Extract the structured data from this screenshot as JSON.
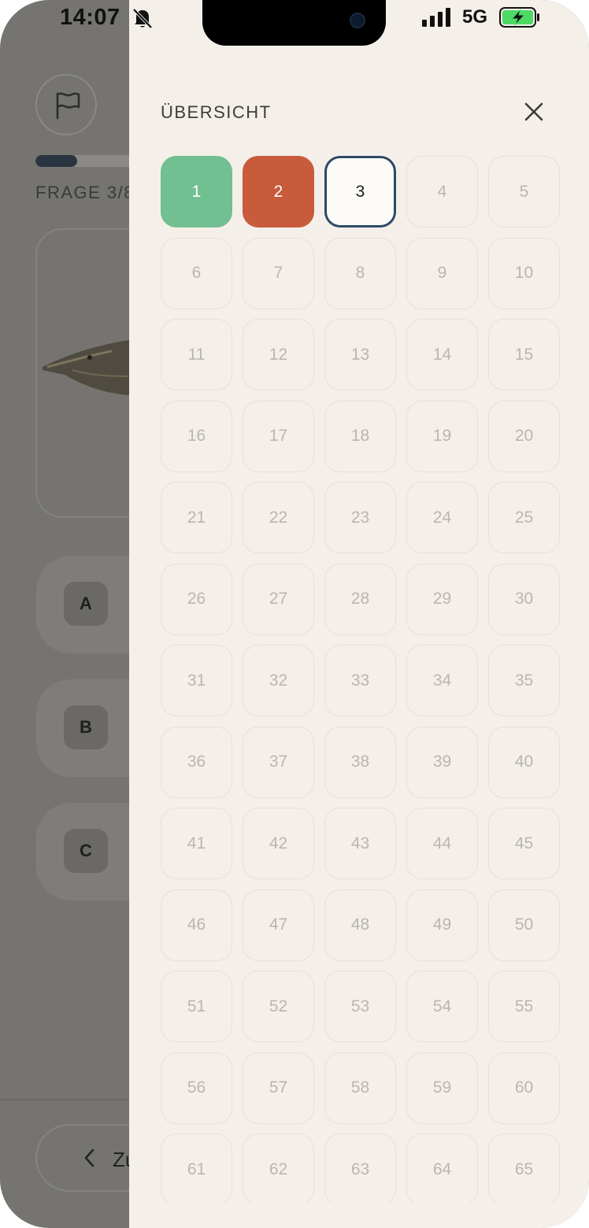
{
  "status_bar": {
    "time": "14:07",
    "network": "5G",
    "icons": [
      "bell-muted-icon",
      "signal-icon",
      "battery-charging-icon"
    ]
  },
  "background_screen": {
    "progress_fraction": 0.375,
    "question_counter_visible": "FRAGE 3/8",
    "answers": [
      "A",
      "B",
      "C"
    ],
    "back_button_visible": "Zu",
    "icons": [
      "flag-icon",
      "chevron-left-icon",
      "pike-fish-image"
    ]
  },
  "overview": {
    "title": "ÜBERSICHT",
    "close_icon": "close-icon",
    "colors": {
      "correct": "#72bf92",
      "wrong": "#c85b3c",
      "current_border": "#2e4a66"
    },
    "questions": [
      {
        "label": "1",
        "state": "correct"
      },
      {
        "label": "2",
        "state": "wrong"
      },
      {
        "label": "3",
        "state": "current"
      },
      {
        "label": "4",
        "state": "open"
      },
      {
        "label": "5",
        "state": "open"
      },
      {
        "label": "6",
        "state": "open"
      },
      {
        "label": "7",
        "state": "open"
      },
      {
        "label": "8",
        "state": "open"
      },
      {
        "label": "9",
        "state": "open"
      },
      {
        "label": "10",
        "state": "open"
      },
      {
        "label": "11",
        "state": "open"
      },
      {
        "label": "12",
        "state": "open"
      },
      {
        "label": "13",
        "state": "open"
      },
      {
        "label": "14",
        "state": "open"
      },
      {
        "label": "15",
        "state": "open"
      },
      {
        "label": "16",
        "state": "open"
      },
      {
        "label": "17",
        "state": "open"
      },
      {
        "label": "18",
        "state": "open"
      },
      {
        "label": "19",
        "state": "open"
      },
      {
        "label": "20",
        "state": "open"
      },
      {
        "label": "21",
        "state": "open"
      },
      {
        "label": "22",
        "state": "open"
      },
      {
        "label": "23",
        "state": "open"
      },
      {
        "label": "24",
        "state": "open"
      },
      {
        "label": "25",
        "state": "open"
      },
      {
        "label": "26",
        "state": "open"
      },
      {
        "label": "27",
        "state": "open"
      },
      {
        "label": "28",
        "state": "open"
      },
      {
        "label": "29",
        "state": "open"
      },
      {
        "label": "30",
        "state": "open"
      },
      {
        "label": "31",
        "state": "open"
      },
      {
        "label": "32",
        "state": "open"
      },
      {
        "label": "33",
        "state": "open"
      },
      {
        "label": "34",
        "state": "open"
      },
      {
        "label": "35",
        "state": "open"
      },
      {
        "label": "36",
        "state": "open"
      },
      {
        "label": "37",
        "state": "open"
      },
      {
        "label": "38",
        "state": "open"
      },
      {
        "label": "39",
        "state": "open"
      },
      {
        "label": "40",
        "state": "open"
      },
      {
        "label": "41",
        "state": "open"
      },
      {
        "label": "42",
        "state": "open"
      },
      {
        "label": "43",
        "state": "open"
      },
      {
        "label": "44",
        "state": "open"
      },
      {
        "label": "45",
        "state": "open"
      },
      {
        "label": "46",
        "state": "open"
      },
      {
        "label": "47",
        "state": "open"
      },
      {
        "label": "48",
        "state": "open"
      },
      {
        "label": "49",
        "state": "open"
      },
      {
        "label": "50",
        "state": "open"
      },
      {
        "label": "51",
        "state": "open"
      },
      {
        "label": "52",
        "state": "open"
      },
      {
        "label": "53",
        "state": "open"
      },
      {
        "label": "54",
        "state": "open"
      },
      {
        "label": "55",
        "state": "open"
      },
      {
        "label": "56",
        "state": "open"
      },
      {
        "label": "57",
        "state": "open"
      },
      {
        "label": "58",
        "state": "open"
      },
      {
        "label": "59",
        "state": "open"
      },
      {
        "label": "60",
        "state": "open"
      },
      {
        "label": "61",
        "state": "open"
      },
      {
        "label": "62",
        "state": "open"
      },
      {
        "label": "63",
        "state": "open"
      },
      {
        "label": "64",
        "state": "open"
      },
      {
        "label": "65",
        "state": "open"
      }
    ]
  }
}
